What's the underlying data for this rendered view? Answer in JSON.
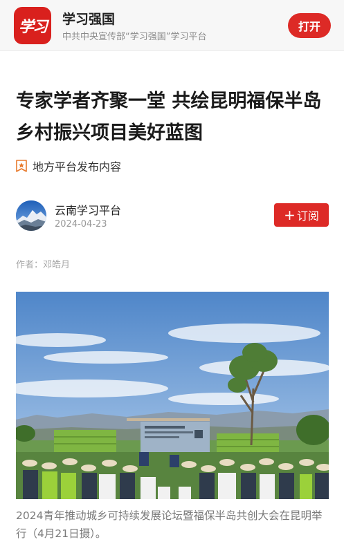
{
  "app": {
    "logo_text": "学习",
    "name": "学习强国",
    "description": "中共中央宣传部“学习强国”学习平台",
    "open_label": "打开"
  },
  "article": {
    "title": "专家学者齐聚一堂 共绘昆明福保半岛乡村振兴项目美好蓝图",
    "source_tag": "地方平台发布内容",
    "account_name": "云南学习平台",
    "date": "2024-04-23",
    "subscribe_label": "订阅",
    "subscribe_plus": "+",
    "author": "作者：邓皓月",
    "caption": "2024青年推动城乡可持续发展论坛暨福保半岛共创大会在昆明举行（4月21日摄）。"
  },
  "colors": {
    "accent": "#dd2a26",
    "topbar_bg": "#f7f7f7"
  },
  "icons": {
    "source_tag": "star-badge-icon",
    "avatar": "mountain-avatar-icon"
  }
}
